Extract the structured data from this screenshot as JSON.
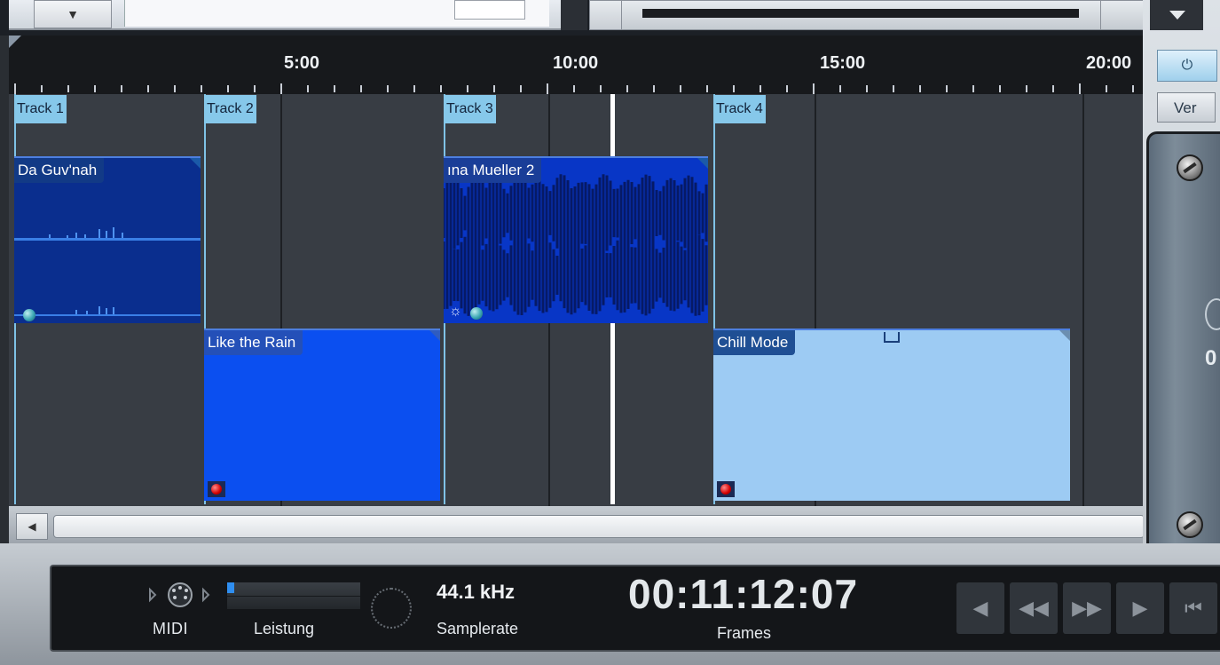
{
  "toolbar_top": {
    "dropdown_glyph": "▼",
    "scroll_glyph": "▾"
  },
  "timeline": {
    "ruler_labels": [
      "5:00",
      "10:00",
      "15:00",
      "20:00"
    ],
    "tracks": [
      {
        "label": "Track 1"
      },
      {
        "label": "Track 2"
      },
      {
        "label": "Track 3"
      },
      {
        "label": "Track 4"
      }
    ],
    "clips": [
      {
        "title": "Da Guv'nah",
        "track": "Track 1",
        "color": "#0a2e8e",
        "icon": "teal-dot-icon"
      },
      {
        "title": "Like the Rain",
        "track": "Track 2",
        "color": "#0b4ff0",
        "icon": "record-dot-icon"
      },
      {
        "title": "ına Mueller 2",
        "track": "Track 3",
        "color": "#0836c6",
        "icon": "teal-dot-icon"
      },
      {
        "title": "Chill Mode",
        "track": "Track 4",
        "color": "#9dcbf3",
        "icon": "record-dot-icon"
      }
    ],
    "playhead_time": "00:11:12:07"
  },
  "scrollbar": {
    "left_arrow_glyph": "◀"
  },
  "right_panel": {
    "power_glyph": "⏻",
    "ver_label": "Ver",
    "plugin_value": "0"
  },
  "transport": {
    "midi_label": "MIDI",
    "performance_label": "Leistung",
    "performance_level": 0.05,
    "samplerate_value": "44.1 kHz",
    "samplerate_label": "Samplerate",
    "timecode": "00:11:12:07",
    "timecode_format_label": "Frames",
    "buttons": [
      {
        "name": "rewind-step-button",
        "glyph": "◀"
      },
      {
        "name": "rewind-button",
        "glyph": "◀◀"
      },
      {
        "name": "fast-forward-button",
        "glyph": "▶▶"
      },
      {
        "name": "play-button",
        "glyph": "▶"
      },
      {
        "name": "return-to-start-button",
        "glyph": "⏮"
      }
    ]
  },
  "colors": {
    "accent": "#86c8ea",
    "playhead": "#ffffff",
    "ruler_background": "#17191c",
    "transport_background": "#141619"
  }
}
